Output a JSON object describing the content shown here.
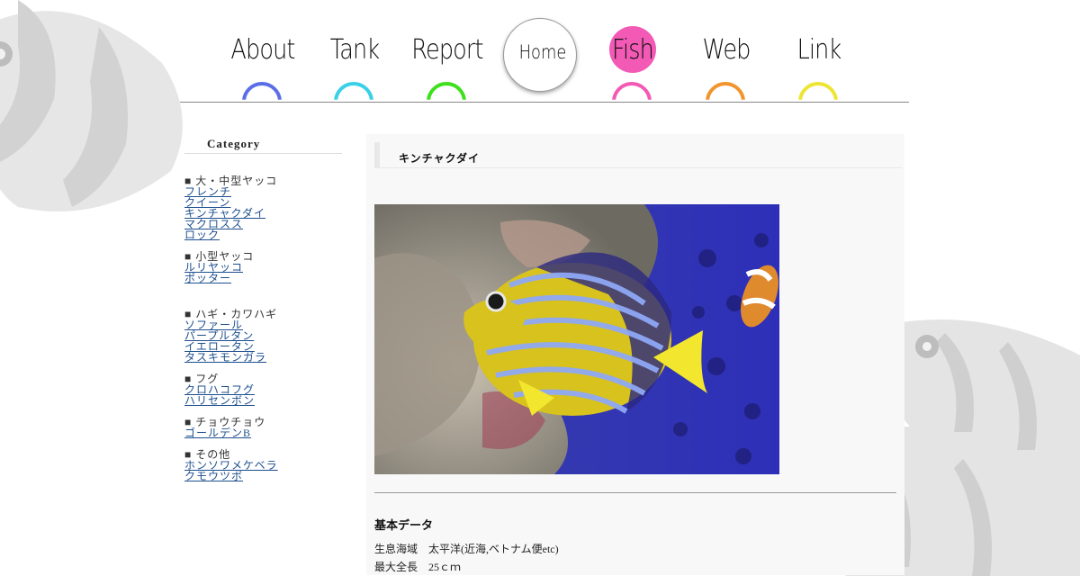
{
  "nav": {
    "items": [
      {
        "label": "About",
        "color": "#5b6ee8"
      },
      {
        "label": "Tank",
        "color": "#39d0e8"
      },
      {
        "label": "Report",
        "color": "#3ee01e"
      },
      {
        "label": "Home",
        "color": ""
      },
      {
        "label": "Fish",
        "color": "#f25ab5"
      },
      {
        "label": "Web",
        "color": "#f2942e"
      },
      {
        "label": "Link",
        "color": "#ede534"
      }
    ]
  },
  "sidebar": {
    "title": "Category",
    "groups": [
      {
        "head": "■ 大・中型ヤッコ",
        "links": [
          "フレンチ",
          "クイーン",
          "キンチャクダイ",
          "マクロスス",
          "ロック"
        ]
      },
      {
        "head": "■ 小型ヤッコ",
        "links": [
          "ルリヤッコ",
          "ポッター"
        ]
      },
      {
        "head": "■ ハギ・カワハギ",
        "links": [
          "ソファール",
          "パープルタン",
          "イエロータン",
          "タスキモンガラ"
        ]
      },
      {
        "head": "■ フグ",
        "links": [
          "クロハコフグ",
          "ハリセンボン"
        ]
      },
      {
        "head": "■ チョウチョウ",
        "links": [
          "ゴールデンB"
        ]
      },
      {
        "head": "■ その他",
        "links": [
          "ホンソワメケベラ",
          "クモウツボ"
        ]
      }
    ]
  },
  "main": {
    "title": "キンチャクダイ",
    "section_title": "基本データ",
    "rows": [
      {
        "key": "生息海域",
        "value": "太平洋(近海,ベトナム便etc)"
      },
      {
        "key": "最大全長",
        "value": "25ｃｍ"
      }
    ]
  }
}
